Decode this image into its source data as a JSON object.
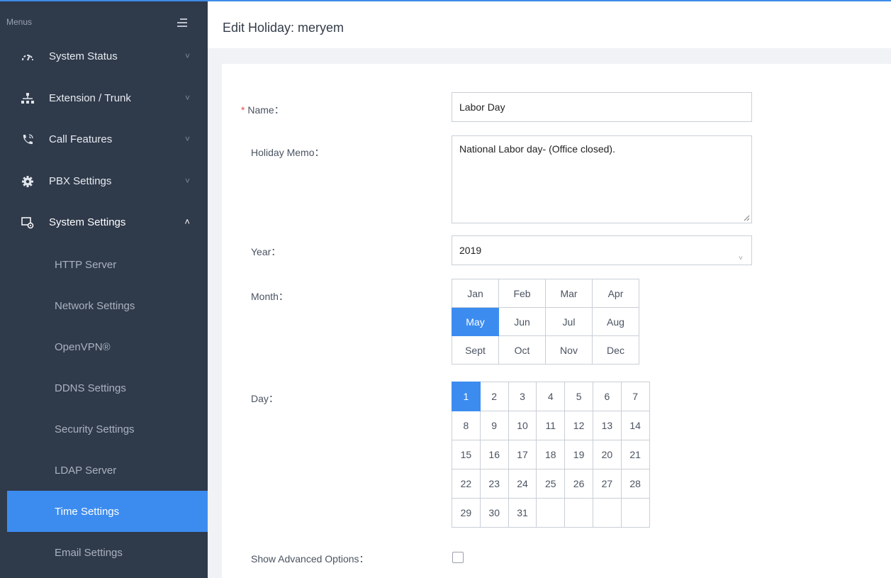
{
  "sidebar": {
    "menus_label": "Menus",
    "items": [
      {
        "label": "System Status",
        "chevron": "˅"
      },
      {
        "label": "Extension / Trunk",
        "chevron": "˅"
      },
      {
        "label": "Call Features",
        "chevron": "˅"
      },
      {
        "label": "PBX Settings",
        "chevron": "˅"
      },
      {
        "label": "System Settings",
        "chevron": "˄"
      }
    ],
    "sub_items": [
      {
        "label": "HTTP Server"
      },
      {
        "label": "Network Settings"
      },
      {
        "label": "OpenVPN®"
      },
      {
        "label": "DDNS Settings"
      },
      {
        "label": "Security Settings"
      },
      {
        "label": "LDAP Server"
      },
      {
        "label": "Time Settings"
      },
      {
        "label": "Email Settings"
      }
    ],
    "active_sub_item": "Time Settings"
  },
  "header": {
    "title": "Edit Holiday: meryem"
  },
  "form": {
    "name": {
      "required_mark": "*",
      "label": "Name：",
      "value": "Labor Day"
    },
    "memo": {
      "label": "Holiday Memo：",
      "value": "National Labor day- (Office closed)."
    },
    "year": {
      "label": "Year：",
      "value": "2019"
    },
    "month": {
      "label": "Month：",
      "options": [
        [
          "Jan",
          "Feb",
          "Mar",
          "Apr"
        ],
        [
          "May",
          "Jun",
          "Jul",
          "Aug"
        ],
        [
          "Sept",
          "Oct",
          "Nov",
          "Dec"
        ]
      ],
      "selected": "May"
    },
    "day": {
      "label": "Day：",
      "rows": [
        [
          "1",
          "2",
          "3",
          "4",
          "5",
          "6",
          "7"
        ],
        [
          "8",
          "9",
          "10",
          "11",
          "12",
          "13",
          "14"
        ],
        [
          "15",
          "16",
          "17",
          "18",
          "19",
          "20",
          "21"
        ],
        [
          "22",
          "23",
          "24",
          "25",
          "26",
          "27",
          "28"
        ],
        [
          "29",
          "30",
          "31",
          "",
          "",
          "",
          ""
        ]
      ],
      "selected": "1"
    },
    "advanced": {
      "label": "Show Advanced Options：",
      "checked": false
    }
  },
  "colors": {
    "accent": "#3c8cf0",
    "sidebar_bg": "#2f3a4b",
    "required": "#e34d4d"
  }
}
